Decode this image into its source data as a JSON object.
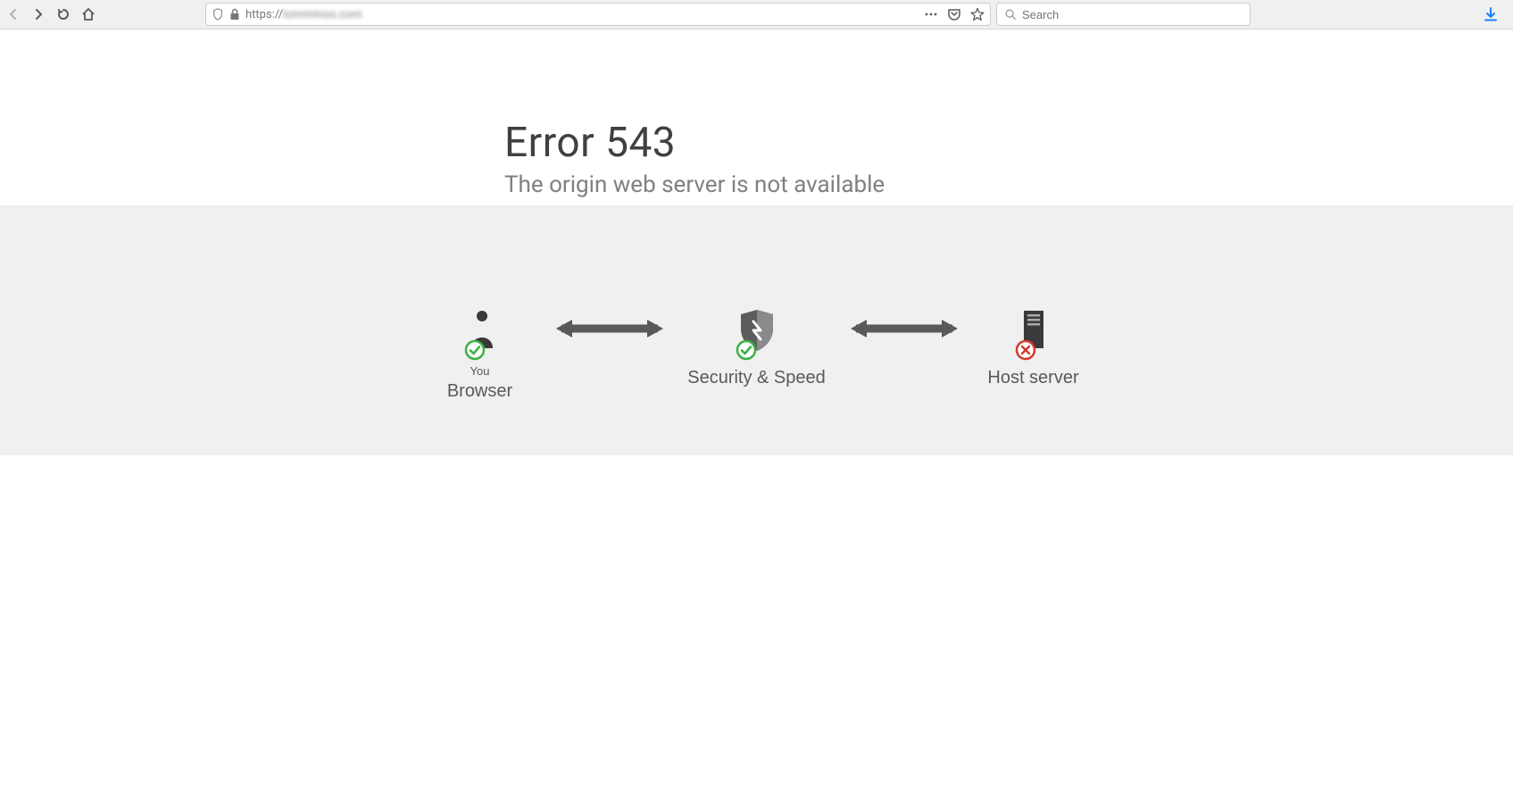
{
  "browser": {
    "url_protocol": "https://",
    "url_domain_obscured": "tomminoo.com",
    "search_placeholder": "Search"
  },
  "page": {
    "title": "Error 543",
    "subtitle": "The origin web server is not available"
  },
  "diagram": {
    "browser": {
      "top": "You",
      "bottom": "Browser",
      "status": "ok"
    },
    "middle": {
      "top": "",
      "bottom": "Security & Speed",
      "status": "ok"
    },
    "host": {
      "top": "",
      "bottom": "Host server",
      "status": "fail"
    }
  }
}
